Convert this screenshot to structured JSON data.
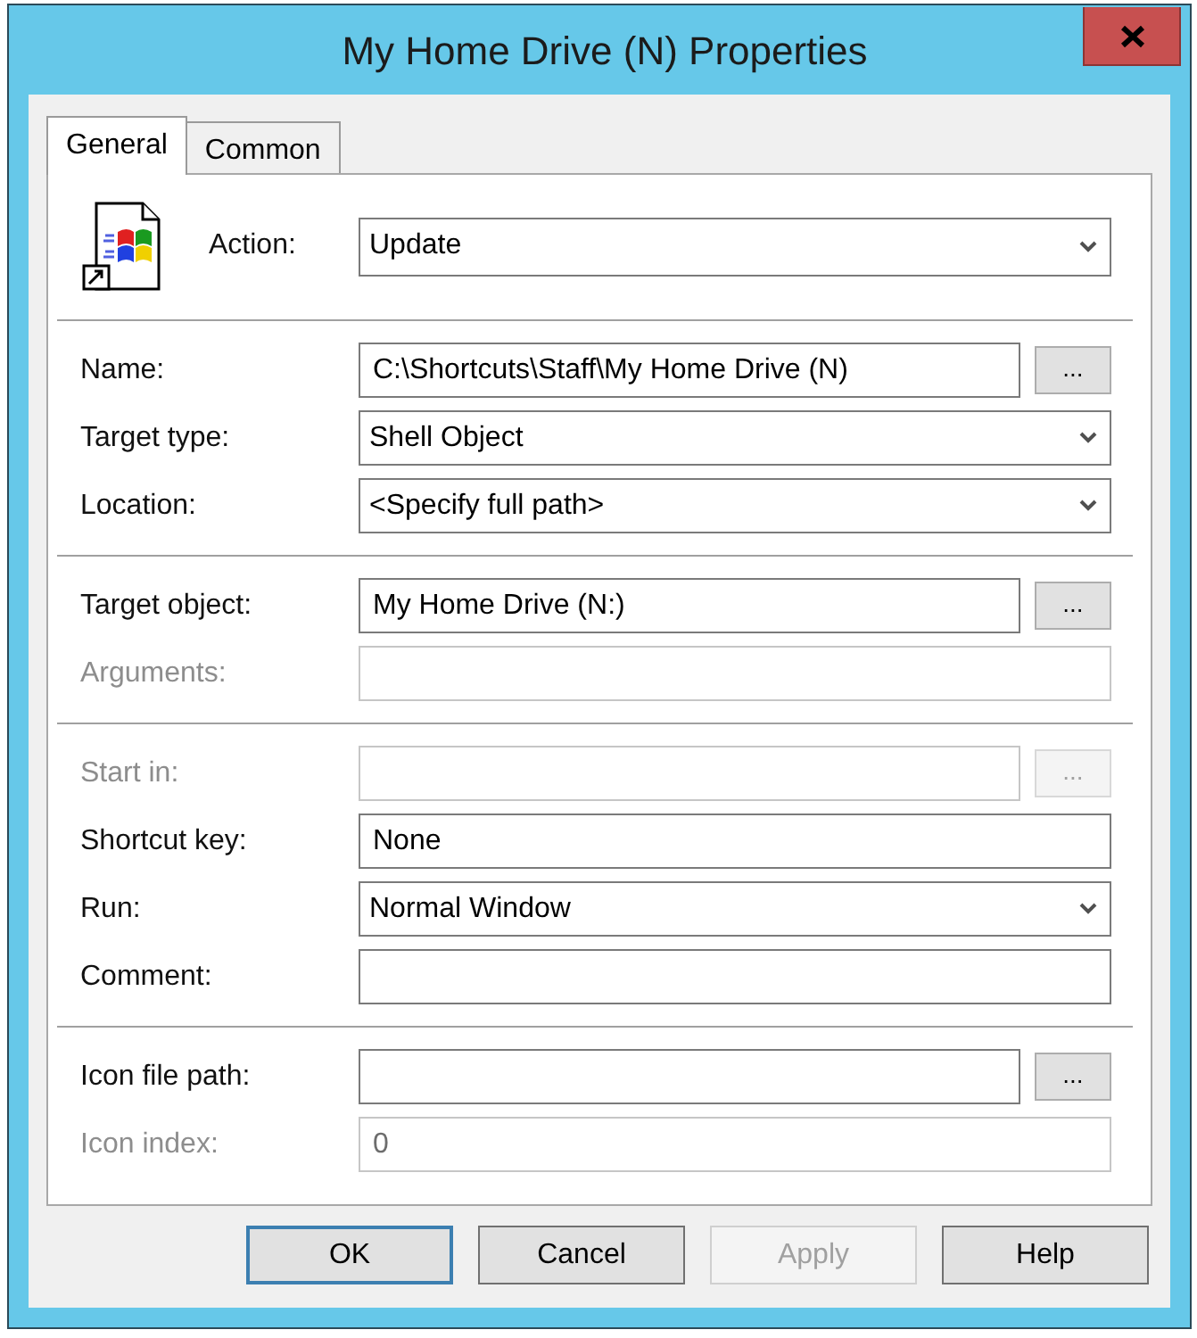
{
  "window": {
    "title": "My Home Drive (N) Properties"
  },
  "tabs": [
    {
      "label": "General",
      "selected": true
    },
    {
      "label": "Common",
      "selected": false
    }
  ],
  "action": {
    "kind": "dropdown",
    "label": "Action:",
    "value": "Update",
    "disabled": false
  },
  "sections": [
    {
      "fields": [
        {
          "kind": "text",
          "label": "Name:",
          "value": "C:\\Shortcuts\\Staff\\My Home Drive (N)",
          "browse": "...",
          "disabled": false
        },
        {
          "kind": "dropdown",
          "label": "Target type:",
          "value": "Shell Object",
          "disabled": false
        },
        {
          "kind": "dropdown",
          "label": "Location:",
          "value": "<Specify full path>",
          "disabled": false
        }
      ]
    },
    {
      "fields": [
        {
          "kind": "text",
          "label": "Target object:",
          "value": "My Home Drive (N:)",
          "browse": "...",
          "disabled": false
        },
        {
          "kind": "text",
          "label": "Arguments:",
          "disabled": true
        }
      ]
    },
    {
      "fields": [
        {
          "kind": "text",
          "label": "Start in:",
          "browse": "...",
          "disabled": true
        },
        {
          "kind": "text",
          "label": "Shortcut key:",
          "value": "None",
          "disabled": false
        },
        {
          "kind": "dropdown",
          "label": "Run:",
          "value": "Normal Window",
          "disabled": false
        },
        {
          "kind": "text",
          "label": "Comment:",
          "disabled": false
        }
      ]
    },
    {
      "fields": [
        {
          "kind": "text",
          "label": "Icon file path:",
          "browse": "...",
          "disabled": false
        },
        {
          "kind": "text",
          "label": "Icon index:",
          "value": "0",
          "disabled": true
        }
      ]
    }
  ],
  "buttons": [
    {
      "label": "OK",
      "focused": true,
      "disabled": false
    },
    {
      "label": "Cancel",
      "focused": false,
      "disabled": false
    },
    {
      "label": "Apply",
      "focused": false,
      "disabled": true
    },
    {
      "label": "Help",
      "focused": false,
      "disabled": false
    }
  ]
}
